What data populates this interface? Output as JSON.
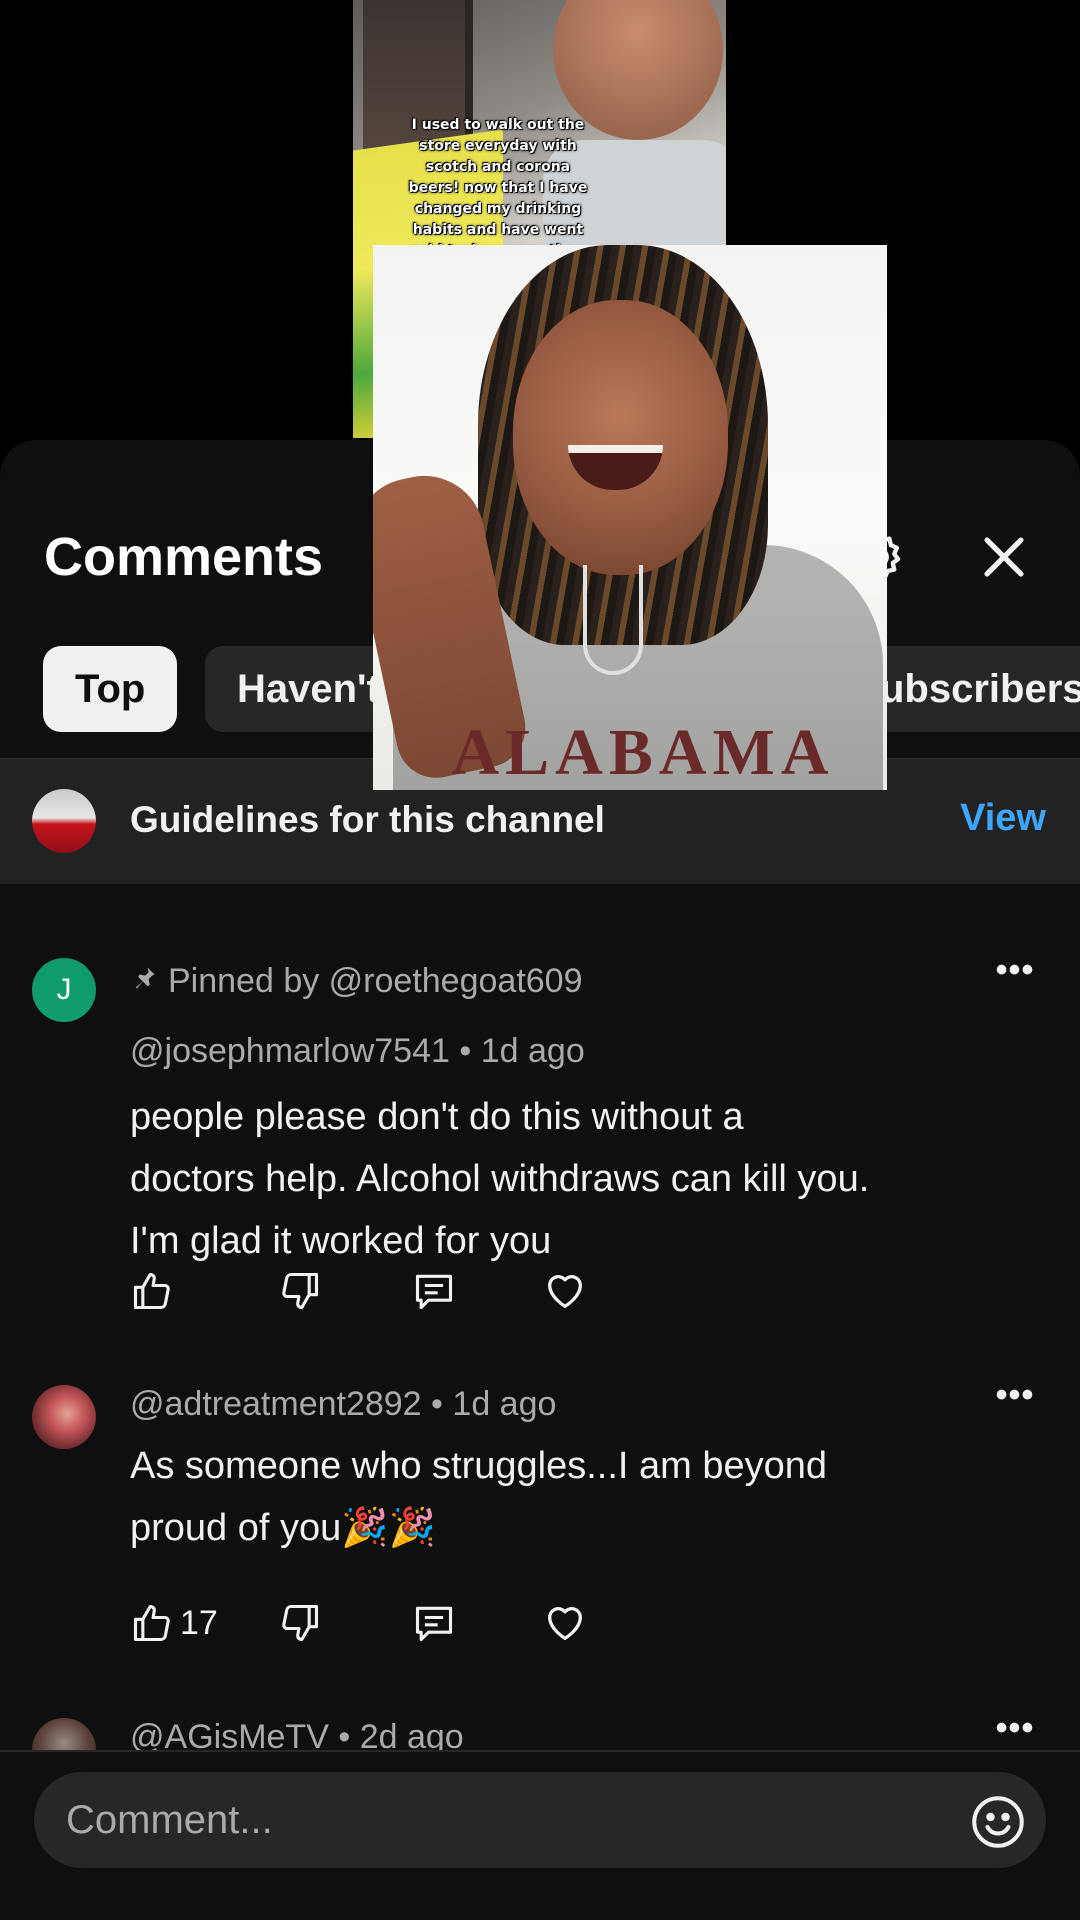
{
  "video": {
    "overlay_text": "I used to walk out the store everyday with scotch and corona beers! now that I have changed my drinking habits and have went cold turkey more than 200 days without having liq... now walking o... waters for... ch..."
  },
  "pip_video": {
    "hoodie_text": "ALABAMA"
  },
  "sheet": {
    "title": "Comments",
    "settings_icon": "gear-icon",
    "close_icon": "close-icon"
  },
  "chips": [
    {
      "label": "Top",
      "active": true
    },
    {
      "label": "Haven't",
      "active": false
    },
    {
      "label": "ubscribers",
      "active": false
    }
  ],
  "guidelines": {
    "label": "Guidelines for this channel",
    "action": "View"
  },
  "comments": [
    {
      "avatar_letter": "J",
      "pinned": "Pinned by @roethegoat609",
      "author": "@josephmarlow7541",
      "time": "1d ago",
      "lines": [
        "people please don't do this without a",
        "doctors help.  Alcohol withdraws can kill you.",
        "I'm glad it worked for you"
      ],
      "likes": ""
    },
    {
      "author": "@adtreatment2892",
      "time": "1d ago",
      "lines": [
        "As someone who struggles...I am beyond",
        "proud of you🎉🎉"
      ],
      "likes": "17"
    },
    {
      "author": "@AGisMeTV",
      "time": "2d ago"
    }
  ],
  "comment_bar": {
    "placeholder": "Comment...",
    "emoji_icon": "emoji-icon"
  },
  "colors": {
    "sheet_bg": "#0f0f0f",
    "chip_bg": "#272727",
    "link": "#3ea6ff",
    "muted_text": "#aaaaaa"
  }
}
